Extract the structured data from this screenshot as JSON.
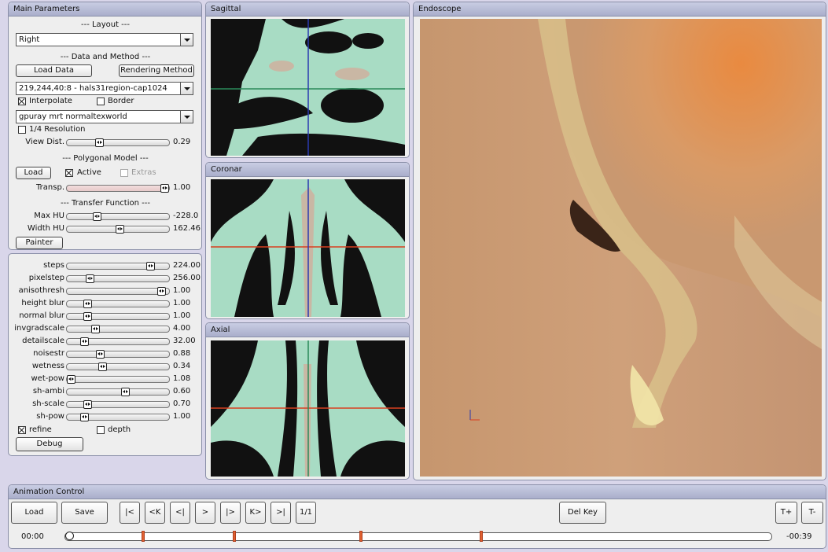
{
  "main_params": {
    "title": "Main Parameters",
    "layout_header": "--- Layout ---",
    "layout_value": "Right",
    "data_header": "--- Data and Method ---",
    "load_data": "Load Data",
    "rendering_method": "Rendering Method",
    "dataset": "219,244,40:8 - hals31region-cap1024",
    "interpolate": {
      "label": "Interpolate",
      "checked": true
    },
    "border": {
      "label": "Border",
      "checked": false
    },
    "renderer": "gpuray mrt normaltexworld",
    "quarter_res": {
      "label": "1/4 Resolution",
      "checked": false
    },
    "view_dist": {
      "label": "View Dist.",
      "value": "0.29",
      "pos": 0.3
    },
    "poly_header": "--- Polygonal Model ---",
    "poly_load": "Load",
    "active": {
      "label": "Active",
      "checked": true
    },
    "extras": {
      "label": "Extras",
      "checked": false
    },
    "transp": {
      "label": "Transp.",
      "value": "1.00",
      "pos": 1.0
    },
    "tf_header": "--- Transfer Function ---",
    "max_hu": {
      "label": "Max HU",
      "value": "-228.0",
      "pos": 0.28
    },
    "width_hu": {
      "label": "Width HU",
      "value": "162.46",
      "pos": 0.52
    },
    "painter": "Painter"
  },
  "render_params": {
    "sliders": [
      {
        "label": "steps",
        "value": "224.00",
        "pos": 0.85
      },
      {
        "label": "pixelstep",
        "value": "256.00",
        "pos": 0.2
      },
      {
        "label": "anisothresh",
        "value": "1.00",
        "pos": 0.97
      },
      {
        "label": "height blur",
        "value": "1.00",
        "pos": 0.18
      },
      {
        "label": "normal blur",
        "value": "1.00",
        "pos": 0.18
      },
      {
        "label": "invgradscale",
        "value": "4.00",
        "pos": 0.26
      },
      {
        "label": "detailscale",
        "value": "32.00",
        "pos": 0.14
      },
      {
        "label": "noisestr",
        "value": "0.88",
        "pos": 0.31
      },
      {
        "label": "wetness",
        "value": "0.34",
        "pos": 0.34
      },
      {
        "label": "wet-pow",
        "value": "1.08",
        "pos": 0.0
      },
      {
        "label": "sh-ambi",
        "value": "0.60",
        "pos": 0.58
      },
      {
        "label": "sh-scale",
        "value": "0.70",
        "pos": 0.18
      },
      {
        "label": "sh-pow",
        "value": "1.00",
        "pos": 0.14
      }
    ],
    "refine": {
      "label": "refine",
      "checked": true
    },
    "depth": {
      "label": "depth",
      "checked": false
    },
    "debug": "Debug"
  },
  "views": {
    "sagittal": "Sagittal",
    "coronal": "Coronar",
    "axial": "Axial",
    "endoscope": "Endoscope"
  },
  "animation": {
    "title": "Animation Control",
    "load": "Load",
    "save": "Save",
    "nav": [
      "|<",
      "<K",
      "<|",
      ">",
      "|>",
      "K>",
      ">|",
      "1/1"
    ],
    "del_key": "Del Key",
    "t_plus": "T+",
    "t_minus": "T-",
    "time_start": "00:00",
    "time_end": "-00:39",
    "playhead_pos": 0.0,
    "keyframes": [
      0.11,
      0.24,
      0.42,
      0.59
    ]
  },
  "colors": {
    "panel_bg": "#eeeeee",
    "title_bar": "#b6bad5",
    "background": "#d9d6ea",
    "keyframe": "#e06030",
    "sagittal_line_h": "#2a8a5a",
    "crosshair_v": "#2a3ab0",
    "crosshair_h": "#d84020"
  }
}
